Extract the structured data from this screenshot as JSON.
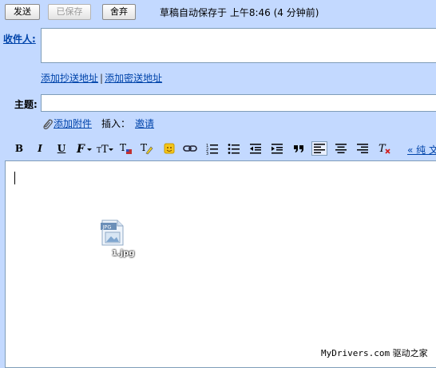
{
  "toolbar": {
    "send_label": "发送",
    "saved_label": "已保存",
    "discard_label": "舍弃",
    "autosave_text": "草稿自动保存于 上午8:46 (4 分钟前)"
  },
  "compose": {
    "to_label": "收件人:",
    "add_cc_label": "添加抄送地址",
    "separator": "|",
    "add_bcc_label": "添加密送地址",
    "subject_label": "主题:",
    "add_attachment_label": "添加附件",
    "insert_label": "插入：",
    "invite_label": "邀请"
  },
  "format_toolbar": {
    "bold": "B",
    "italic": "I",
    "underline": "U",
    "plain_text_link": "« 纯 文"
  },
  "editor": {
    "file_icon_type": "JPG",
    "file_name": "1.jpg"
  },
  "watermark": {
    "site": "MyDrivers.com",
    "brand": "驱动之家"
  },
  "colors": {
    "background": "#c3d9ff",
    "link": "#0044aa",
    "field_border": "#7f9db9"
  }
}
